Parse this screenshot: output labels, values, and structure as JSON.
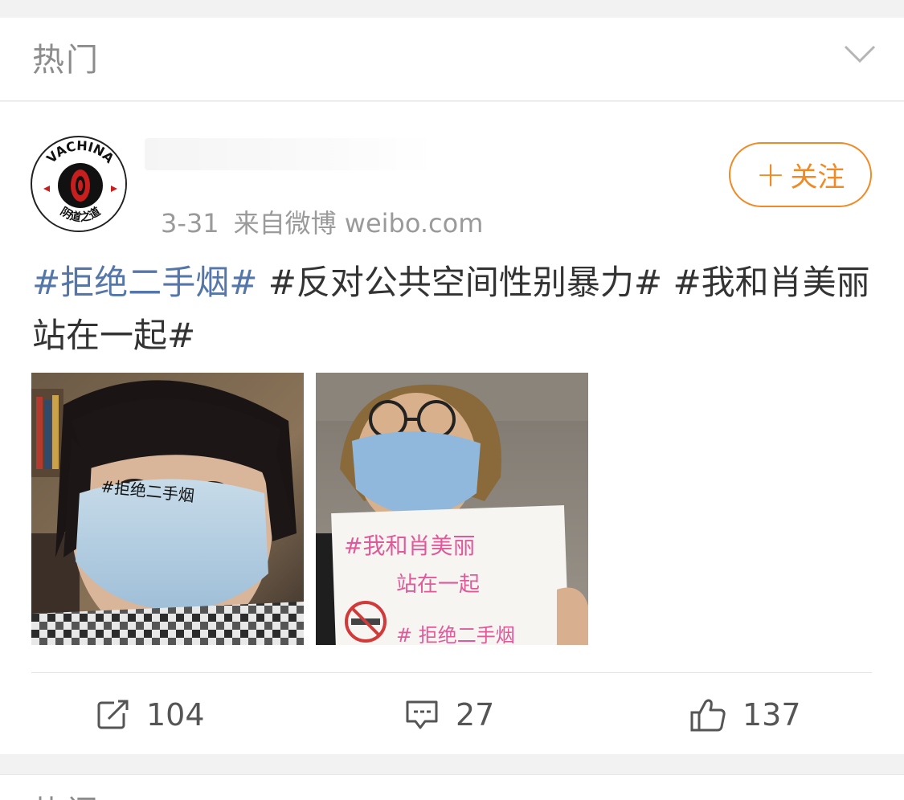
{
  "section": {
    "title": "热门"
  },
  "post": {
    "avatar_text": {
      "top": "VACHINA",
      "bottom": "阴道之道"
    },
    "date": "3-31",
    "source": "来自微博 weibo.com",
    "follow_label": "关注",
    "text_segments": [
      {
        "text": "#拒绝二手烟#",
        "type": "tag"
      },
      {
        "text": " #反对公共空间性别暴力# #我和肖美丽站在一起#",
        "type": "plain"
      }
    ],
    "images": [
      {
        "name": "photo-mask-portrait",
        "handwriting": "#拒绝二手烟"
      },
      {
        "name": "photo-sign-portrait",
        "handwriting_line1": "#我和肖美丽",
        "handwriting_line2": "站在一起",
        "handwriting_line3": "# 拒绝二手烟"
      }
    ],
    "actions": {
      "repost_count": "104",
      "comment_count": "27",
      "like_count": "137"
    }
  },
  "next_section": {
    "title": "热门"
  },
  "colors": {
    "accent": "#f08a25",
    "tag": "#5576a8",
    "muted": "#9a9a9a"
  }
}
